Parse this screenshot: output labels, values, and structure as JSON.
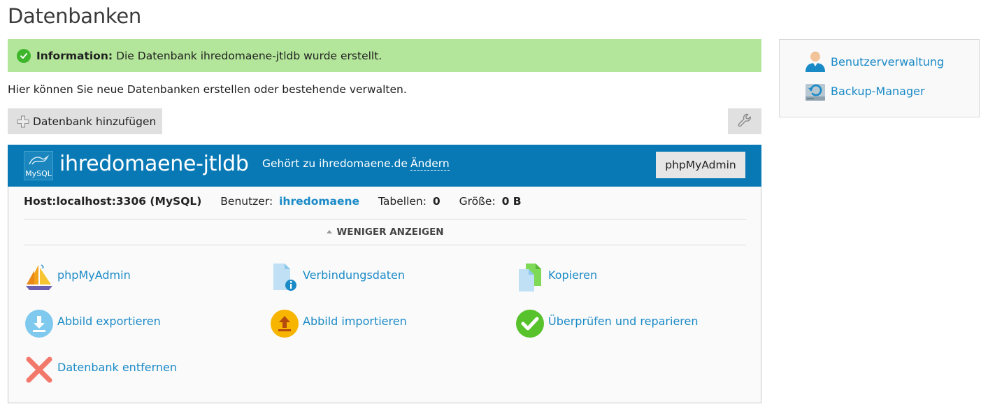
{
  "page": {
    "title": "Datenbanken"
  },
  "info": {
    "label": "Information:",
    "message": "Die Datenbank ihredomaene-jtldb wurde erstellt."
  },
  "description": "Hier können Sie neue Datenbanken erstellen oder bestehende verwalten.",
  "toolbar": {
    "add_label": "Datenbank hinzufügen",
    "tools_icon": "wrench-icon"
  },
  "database": {
    "logo_text": "MySQL",
    "name": "ihredomaene-jtldb",
    "belongs_to": "Gehört zu ihredomaene.de",
    "change_label": "Ändern",
    "pma_button": "phpMyAdmin",
    "host": "Host:localhost:3306 (MySQL)",
    "user_label": "Benutzer:",
    "user": "ihredomaene",
    "tables_label": "Tabellen:",
    "tables": "0",
    "size_label": "Größe:",
    "size": "0 B",
    "toggle_label": "WENIGER ANZEIGEN"
  },
  "actions": [
    {
      "label": "phpMyAdmin",
      "icon": "sailboat-icon"
    },
    {
      "label": "Verbindungsdaten",
      "icon": "info-document-icon"
    },
    {
      "label": "Kopieren",
      "icon": "copy-icon"
    },
    {
      "label": "Abbild exportieren",
      "icon": "export-icon"
    },
    {
      "label": "Abbild importieren",
      "icon": "import-icon"
    },
    {
      "label": "Überprüfen und reparieren",
      "icon": "check-icon"
    },
    {
      "label": "Datenbank entfernen",
      "icon": "remove-icon"
    }
  ],
  "sidebar": {
    "links": [
      {
        "label": "Benutzerverwaltung",
        "icon": "user-icon"
      },
      {
        "label": "Backup-Manager",
        "icon": "backup-icon"
      }
    ]
  },
  "colors": {
    "header_blue": "#0879b5",
    "info_green": "#b3e69a",
    "link_blue": "#1a8ac7"
  }
}
